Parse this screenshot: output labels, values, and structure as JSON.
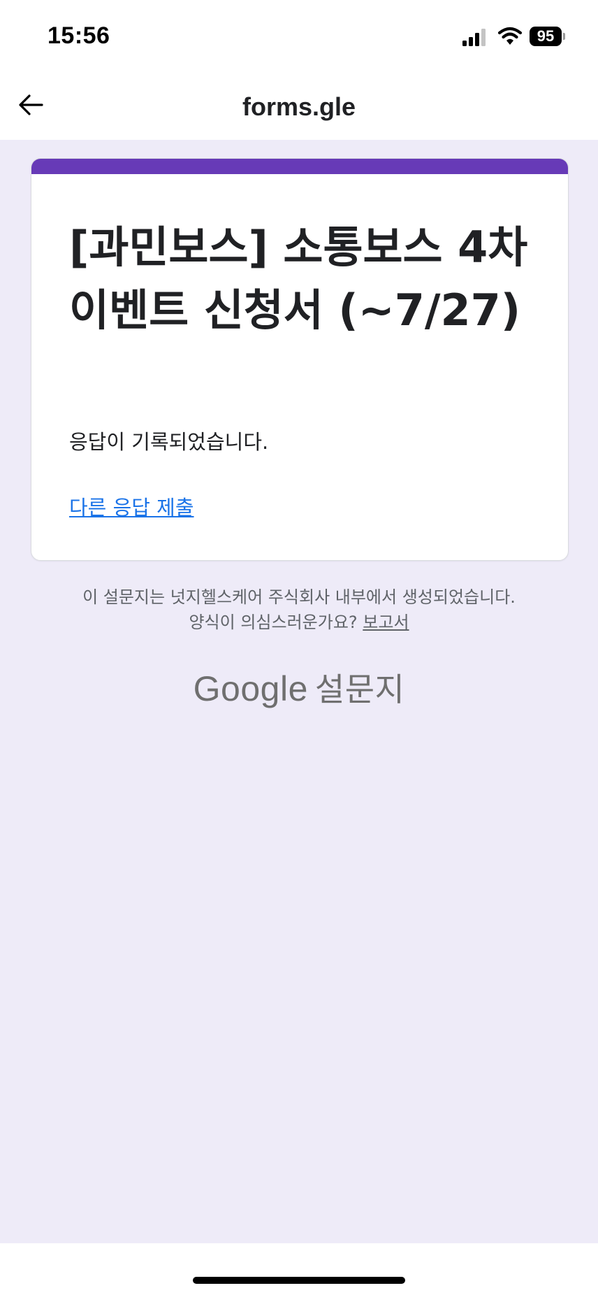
{
  "status_bar": {
    "time": "15:56",
    "battery_level": "95",
    "signal_icon": "cellular-signal-icon",
    "wifi_icon": "wifi-icon"
  },
  "navbar": {
    "back_icon": "arrow-left-icon",
    "title": "forms.gle"
  },
  "form": {
    "accent_color": "#673ab7",
    "title": "[과민보스] 소통보스 4차 이벤트 신청서 (~7/27)",
    "confirmation": "응답이 기록되었습니다.",
    "resubmit_link": "다른 응답 제출"
  },
  "footer": {
    "created_note": "이 설문지는 넛지헬스케어 주식회사 내부에서 생성되었습니다.",
    "suspicious_prompt": "양식이 의심스러운가요?",
    "report_link": "보고서",
    "brand_google": "Google",
    "brand_product": "설문지"
  },
  "colors": {
    "background": "#eeebf8",
    "link": "#1a73e8"
  }
}
